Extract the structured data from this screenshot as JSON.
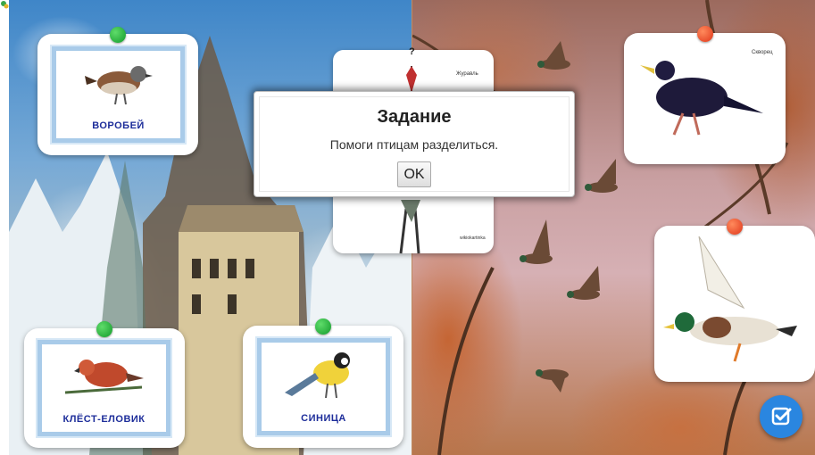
{
  "cards": {
    "sparrow": {
      "label": "ВОРОБЕЙ"
    },
    "crossbill": {
      "label": "КЛЁСТ-ЕЛОВИК"
    },
    "tit": {
      "label": "СИНИЦА"
    },
    "crane": {
      "caption": "Журавль",
      "footer": "wikiokartinka"
    },
    "starling": {
      "caption": "Скворец"
    },
    "duck": {}
  },
  "dialog": {
    "title": "Задание",
    "message": "Помоги птицам разделиться.",
    "ok_label": "OK"
  },
  "help": {
    "label": "?"
  },
  "colors": {
    "pin_green": "#119a2a",
    "pin_red": "#e0361a",
    "card_frame": "#a9cbe9",
    "label_text": "#1d2d9a",
    "check_button": "#2a86e0"
  },
  "icons": [
    "app-logo-icon",
    "help-icon",
    "check-icon"
  ]
}
